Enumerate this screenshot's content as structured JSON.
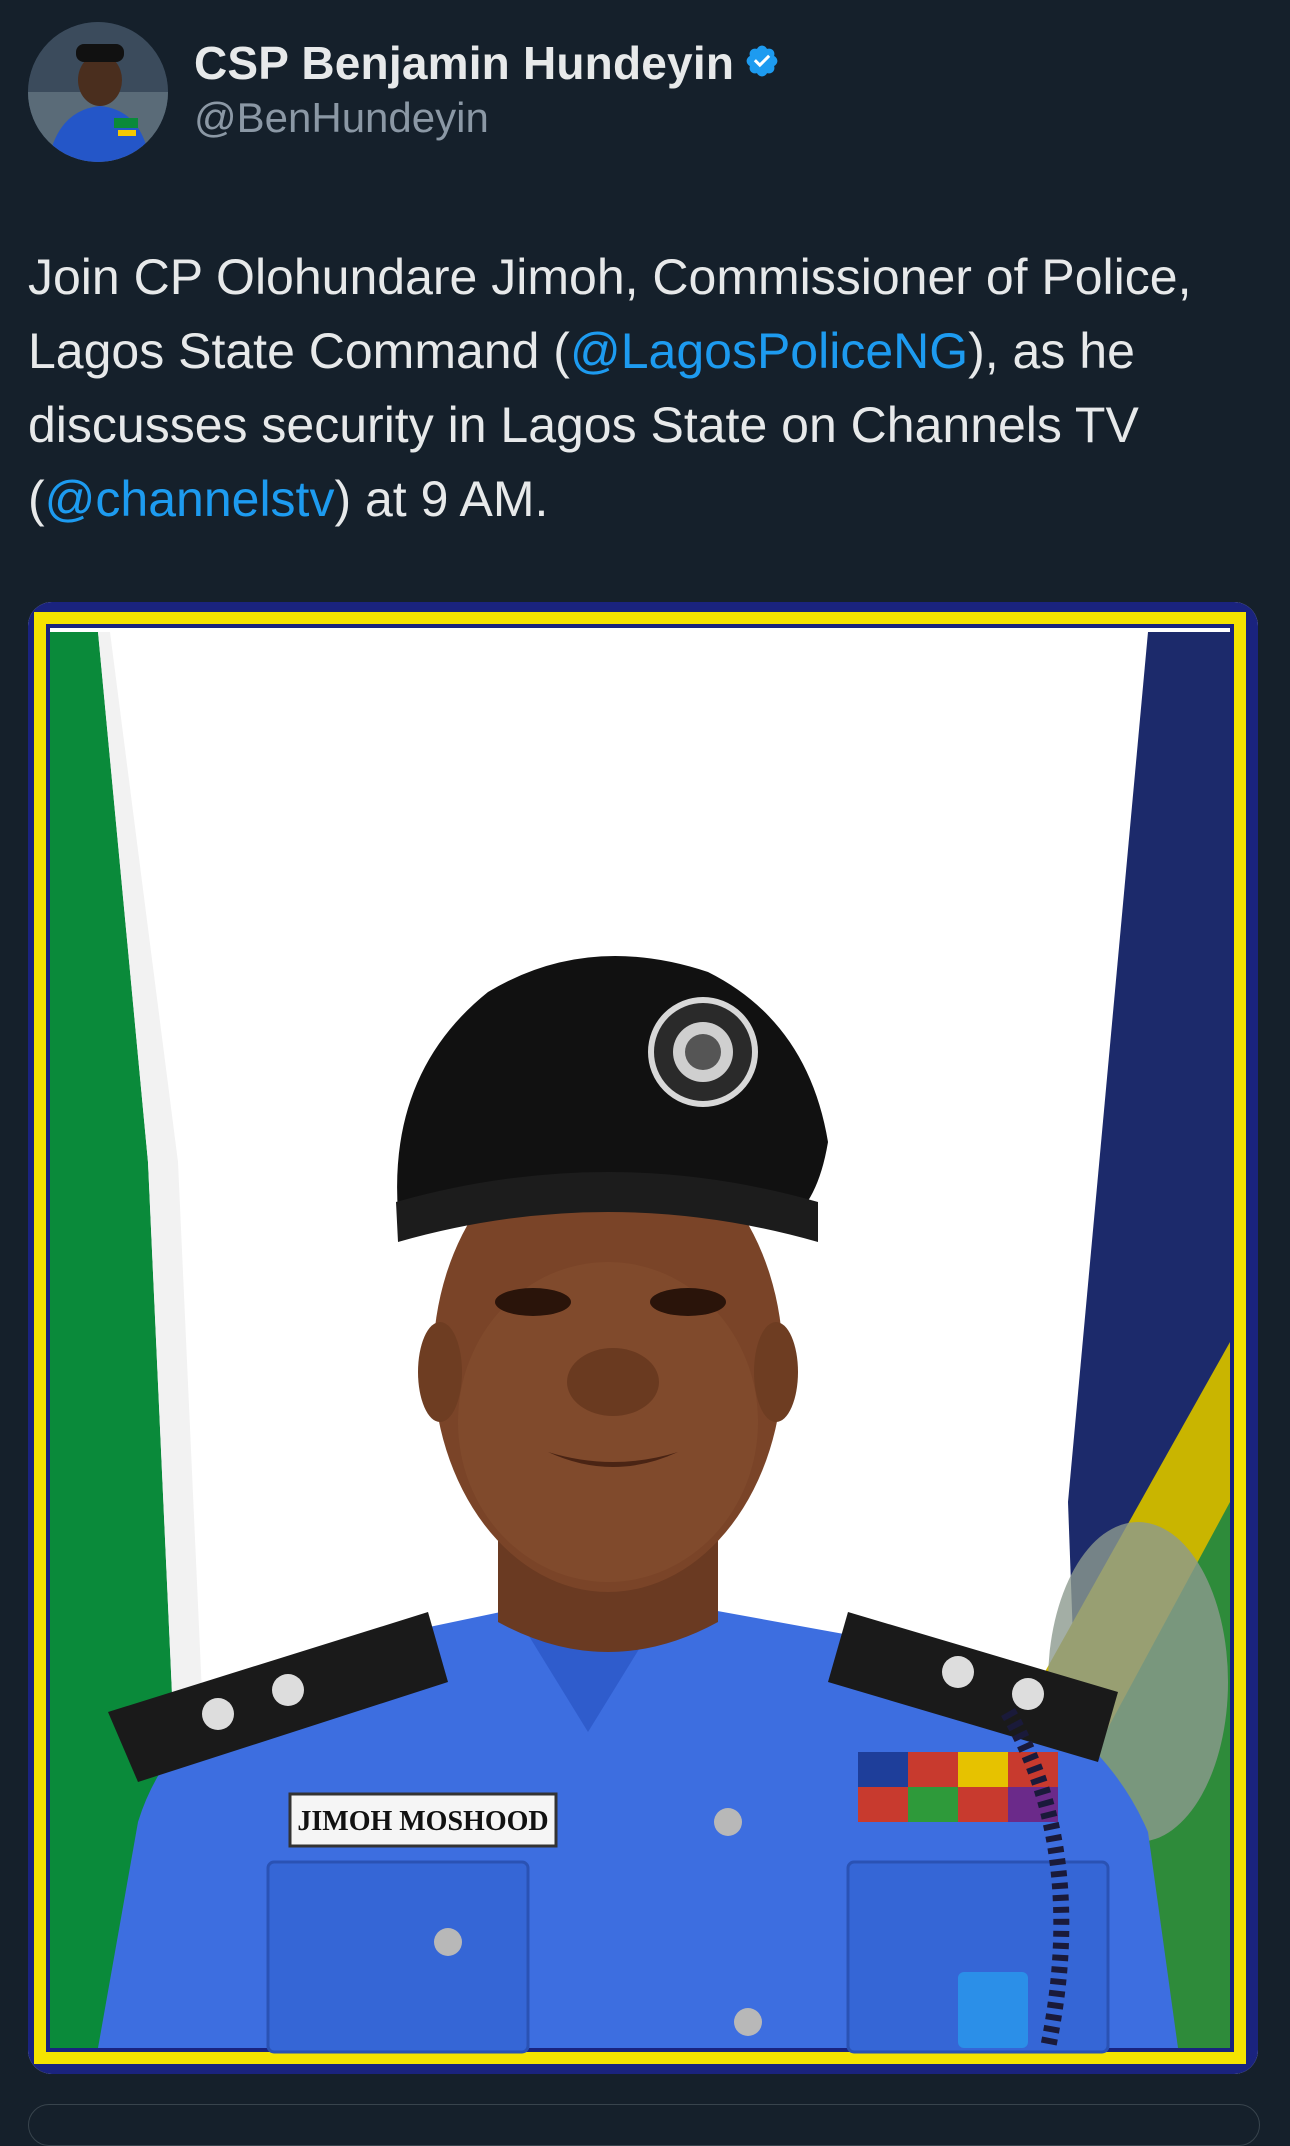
{
  "author": {
    "display_name": "CSP Benjamin Hundeyin",
    "handle": "@BenHundeyin",
    "verified_icon": "verified-badge-icon",
    "badge_color": "#1d9bf0"
  },
  "tweet": {
    "text_1": "Join CP Olohundare Jimoh, Commissioner of Police, Lagos State Command (",
    "mention_1": "@LagosPoliceNG",
    "text_2": "), as he discusses security in Lagos State on Channels TV (",
    "mention_2": "@channelstv",
    "text_3": ") at 9 AM."
  },
  "media": {
    "name_tag": "JIMOH MOSHOOD",
    "frame_colors": [
      "#1a237e",
      "#f5e300",
      "#0a8a3a"
    ]
  }
}
